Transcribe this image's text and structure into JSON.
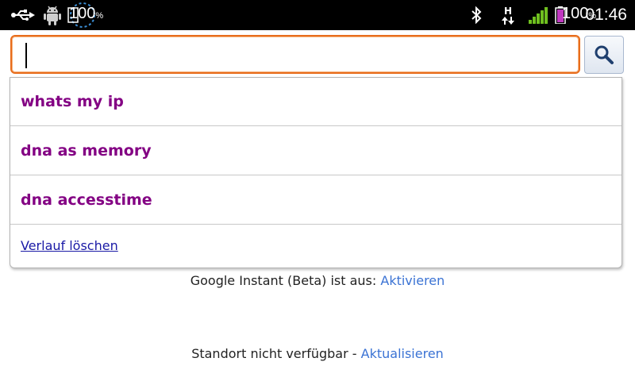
{
  "status_bar": {
    "icons": [
      "usb-icon",
      "android-debug-icon",
      "sdcard-progress-icon",
      "bluetooth-icon",
      "hspa-icon",
      "signal-icon",
      "battery-icon"
    ],
    "left_percent": "100",
    "left_percent_sign": "%",
    "network_type": "H",
    "battery_percent": "100",
    "battery_percent_sign": "%",
    "time": "01:46"
  },
  "search": {
    "value": "",
    "placeholder": "",
    "button_icon": "search-icon"
  },
  "suggestions": {
    "items": [
      {
        "label": "whats my ip"
      },
      {
        "label": "dna as memory"
      },
      {
        "label": "dna accesstime"
      }
    ],
    "clear_history_label": "Verlauf löschen"
  },
  "instant": {
    "text": "Google Instant (Beta) ist aus: ",
    "link": "Aktivieren"
  },
  "location": {
    "text": "Standort nicht verfügbar - ",
    "link": "Aktualisieren"
  },
  "colors": {
    "focus_border": "#e86d1c",
    "suggestion_text": "#830083",
    "link": "#3b73d4",
    "clear_link": "#1a1aa6"
  }
}
